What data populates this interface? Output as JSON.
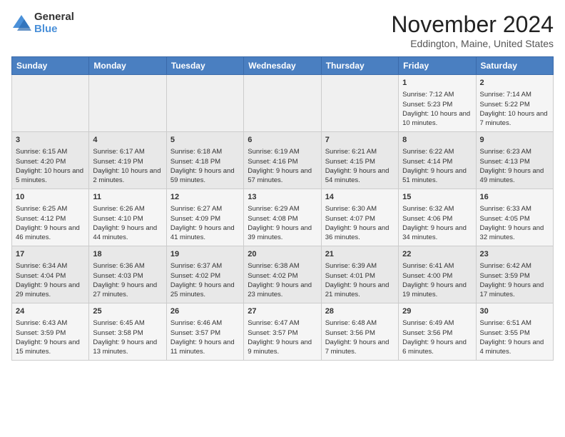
{
  "header": {
    "logo_general": "General",
    "logo_blue": "Blue",
    "month_title": "November 2024",
    "location": "Eddington, Maine, United States"
  },
  "days_of_week": [
    "Sunday",
    "Monday",
    "Tuesday",
    "Wednesday",
    "Thursday",
    "Friday",
    "Saturday"
  ],
  "weeks": [
    [
      {
        "day": "",
        "sunrise": "",
        "sunset": "",
        "daylight": ""
      },
      {
        "day": "",
        "sunrise": "",
        "sunset": "",
        "daylight": ""
      },
      {
        "day": "",
        "sunrise": "",
        "sunset": "",
        "daylight": ""
      },
      {
        "day": "",
        "sunrise": "",
        "sunset": "",
        "daylight": ""
      },
      {
        "day": "",
        "sunrise": "",
        "sunset": "",
        "daylight": ""
      },
      {
        "day": "1",
        "sunrise": "Sunrise: 7:12 AM",
        "sunset": "Sunset: 5:23 PM",
        "daylight": "Daylight: 10 hours and 10 minutes."
      },
      {
        "day": "2",
        "sunrise": "Sunrise: 7:14 AM",
        "sunset": "Sunset: 5:22 PM",
        "daylight": "Daylight: 10 hours and 7 minutes."
      }
    ],
    [
      {
        "day": "3",
        "sunrise": "Sunrise: 6:15 AM",
        "sunset": "Sunset: 4:20 PM",
        "daylight": "Daylight: 10 hours and 5 minutes."
      },
      {
        "day": "4",
        "sunrise": "Sunrise: 6:17 AM",
        "sunset": "Sunset: 4:19 PM",
        "daylight": "Daylight: 10 hours and 2 minutes."
      },
      {
        "day": "5",
        "sunrise": "Sunrise: 6:18 AM",
        "sunset": "Sunset: 4:18 PM",
        "daylight": "Daylight: 9 hours and 59 minutes."
      },
      {
        "day": "6",
        "sunrise": "Sunrise: 6:19 AM",
        "sunset": "Sunset: 4:16 PM",
        "daylight": "Daylight: 9 hours and 57 minutes."
      },
      {
        "day": "7",
        "sunrise": "Sunrise: 6:21 AM",
        "sunset": "Sunset: 4:15 PM",
        "daylight": "Daylight: 9 hours and 54 minutes."
      },
      {
        "day": "8",
        "sunrise": "Sunrise: 6:22 AM",
        "sunset": "Sunset: 4:14 PM",
        "daylight": "Daylight: 9 hours and 51 minutes."
      },
      {
        "day": "9",
        "sunrise": "Sunrise: 6:23 AM",
        "sunset": "Sunset: 4:13 PM",
        "daylight": "Daylight: 9 hours and 49 minutes."
      }
    ],
    [
      {
        "day": "10",
        "sunrise": "Sunrise: 6:25 AM",
        "sunset": "Sunset: 4:12 PM",
        "daylight": "Daylight: 9 hours and 46 minutes."
      },
      {
        "day": "11",
        "sunrise": "Sunrise: 6:26 AM",
        "sunset": "Sunset: 4:10 PM",
        "daylight": "Daylight: 9 hours and 44 minutes."
      },
      {
        "day": "12",
        "sunrise": "Sunrise: 6:27 AM",
        "sunset": "Sunset: 4:09 PM",
        "daylight": "Daylight: 9 hours and 41 minutes."
      },
      {
        "day": "13",
        "sunrise": "Sunrise: 6:29 AM",
        "sunset": "Sunset: 4:08 PM",
        "daylight": "Daylight: 9 hours and 39 minutes."
      },
      {
        "day": "14",
        "sunrise": "Sunrise: 6:30 AM",
        "sunset": "Sunset: 4:07 PM",
        "daylight": "Daylight: 9 hours and 36 minutes."
      },
      {
        "day": "15",
        "sunrise": "Sunrise: 6:32 AM",
        "sunset": "Sunset: 4:06 PM",
        "daylight": "Daylight: 9 hours and 34 minutes."
      },
      {
        "day": "16",
        "sunrise": "Sunrise: 6:33 AM",
        "sunset": "Sunset: 4:05 PM",
        "daylight": "Daylight: 9 hours and 32 minutes."
      }
    ],
    [
      {
        "day": "17",
        "sunrise": "Sunrise: 6:34 AM",
        "sunset": "Sunset: 4:04 PM",
        "daylight": "Daylight: 9 hours and 29 minutes."
      },
      {
        "day": "18",
        "sunrise": "Sunrise: 6:36 AM",
        "sunset": "Sunset: 4:03 PM",
        "daylight": "Daylight: 9 hours and 27 minutes."
      },
      {
        "day": "19",
        "sunrise": "Sunrise: 6:37 AM",
        "sunset": "Sunset: 4:02 PM",
        "daylight": "Daylight: 9 hours and 25 minutes."
      },
      {
        "day": "20",
        "sunrise": "Sunrise: 6:38 AM",
        "sunset": "Sunset: 4:02 PM",
        "daylight": "Daylight: 9 hours and 23 minutes."
      },
      {
        "day": "21",
        "sunrise": "Sunrise: 6:39 AM",
        "sunset": "Sunset: 4:01 PM",
        "daylight": "Daylight: 9 hours and 21 minutes."
      },
      {
        "day": "22",
        "sunrise": "Sunrise: 6:41 AM",
        "sunset": "Sunset: 4:00 PM",
        "daylight": "Daylight: 9 hours and 19 minutes."
      },
      {
        "day": "23",
        "sunrise": "Sunrise: 6:42 AM",
        "sunset": "Sunset: 3:59 PM",
        "daylight": "Daylight: 9 hours and 17 minutes."
      }
    ],
    [
      {
        "day": "24",
        "sunrise": "Sunrise: 6:43 AM",
        "sunset": "Sunset: 3:59 PM",
        "daylight": "Daylight: 9 hours and 15 minutes."
      },
      {
        "day": "25",
        "sunrise": "Sunrise: 6:45 AM",
        "sunset": "Sunset: 3:58 PM",
        "daylight": "Daylight: 9 hours and 13 minutes."
      },
      {
        "day": "26",
        "sunrise": "Sunrise: 6:46 AM",
        "sunset": "Sunset: 3:57 PM",
        "daylight": "Daylight: 9 hours and 11 minutes."
      },
      {
        "day": "27",
        "sunrise": "Sunrise: 6:47 AM",
        "sunset": "Sunset: 3:57 PM",
        "daylight": "Daylight: 9 hours and 9 minutes."
      },
      {
        "day": "28",
        "sunrise": "Sunrise: 6:48 AM",
        "sunset": "Sunset: 3:56 PM",
        "daylight": "Daylight: 9 hours and 7 minutes."
      },
      {
        "day": "29",
        "sunrise": "Sunrise: 6:49 AM",
        "sunset": "Sunset: 3:56 PM",
        "daylight": "Daylight: 9 hours and 6 minutes."
      },
      {
        "day": "30",
        "sunrise": "Sunrise: 6:51 AM",
        "sunset": "Sunset: 3:55 PM",
        "daylight": "Daylight: 9 hours and 4 minutes."
      }
    ]
  ]
}
